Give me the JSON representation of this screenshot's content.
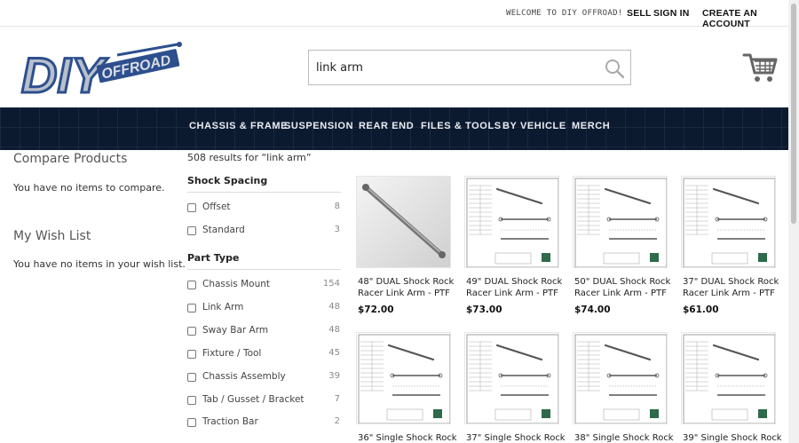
{
  "topbar": {
    "welcome": "WELCOME TO DIY OFFROAD!",
    "sell": "SELL",
    "sign_in": "SIGN IN",
    "create_account": "CREATE AN ACCOUNT"
  },
  "logo": {
    "primary": "DIY",
    "secondary": "OFFROAD"
  },
  "search": {
    "value": "link arm",
    "icon": "search-icon"
  },
  "cart": {
    "icon": "cart-icon"
  },
  "nav": [
    "CHASSIS & FRAME",
    "SUSPENSION",
    "REAR END",
    "FILES & TOOLS",
    "BY VEHICLE",
    "MERCH"
  ],
  "sidebar": {
    "compare_title": "Compare Products",
    "compare_text": "You have no items to compare.",
    "wishlist_title": "My Wish List",
    "wishlist_text": "You have no items in your wish list."
  },
  "results_count": "508 results for “link arm”",
  "facets": [
    {
      "title": "Shock Spacing",
      "options": [
        {
          "label": "Offset",
          "count": "8"
        },
        {
          "label": "Standard",
          "count": "3"
        }
      ]
    },
    {
      "title": "Part Type",
      "options": [
        {
          "label": "Chassis Mount",
          "count": "154"
        },
        {
          "label": "Link Arm",
          "count": "48"
        },
        {
          "label": "Sway Bar Arm",
          "count": "48"
        },
        {
          "label": "Fixture / Tool",
          "count": "45"
        },
        {
          "label": "Chassis Assembly",
          "count": "39"
        },
        {
          "label": "Tab / Gusset / Bracket",
          "count": "7"
        },
        {
          "label": "Traction Bar",
          "count": "2"
        }
      ]
    }
  ],
  "products": [
    {
      "name_line1": "48\" DUAL Shock Rock",
      "name_line2": "Racer Link Arm - PTF",
      "price": "$72.00",
      "image": "photo"
    },
    {
      "name_line1": "49\" DUAL Shock Rock",
      "name_line2": "Racer Link Arm - PTF",
      "price": "$73.00",
      "image": "drawing"
    },
    {
      "name_line1": "50\" DUAL Shock Rock",
      "name_line2": "Racer Link Arm - PTF",
      "price": "$74.00",
      "image": "drawing"
    },
    {
      "name_line1": "37\" DUAL Shock Rock",
      "name_line2": "Racer Link Arm - PTF",
      "price": "$61.00",
      "image": "drawing"
    },
    {
      "name_line1": "36\" Single Shock Rock",
      "name_line2": "",
      "price": "",
      "image": "drawing"
    },
    {
      "name_line1": "37\" Single Shock Rock",
      "name_line2": "",
      "price": "",
      "image": "drawing"
    },
    {
      "name_line1": "38\" Single Shock Rock",
      "name_line2": "",
      "price": "",
      "image": "drawing"
    },
    {
      "name_line1": "39\" Single Shock Rock",
      "name_line2": "",
      "price": "",
      "image": "drawing"
    }
  ],
  "colors": {
    "nav_bg": "#0c1a30",
    "nav_text": "#e9edf3",
    "logo_blue": "#2d4f8e",
    "logo_silver": "#b8c0cc"
  }
}
